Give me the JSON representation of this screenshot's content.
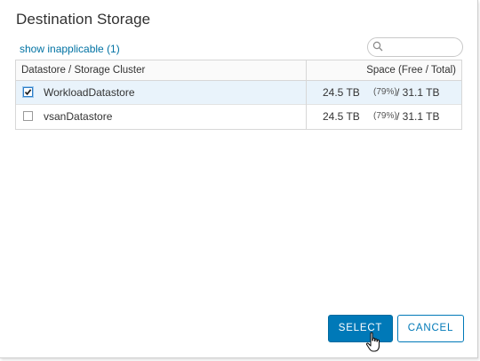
{
  "dialog": {
    "title": "Destination Storage",
    "show_inapplicable": "show inapplicable (1)",
    "search": {
      "value": "",
      "placeholder": ""
    }
  },
  "grid": {
    "columns": [
      "Datastore / Storage Cluster",
      "Space (Free / Total)"
    ],
    "rows": [
      {
        "name": "WorkloadDatastore",
        "checked": true,
        "free": "24.5 TB",
        "percent": "(79%)",
        "total": "/ 31.1 TB"
      },
      {
        "name": "vsanDatastore",
        "checked": false,
        "free": "24.5 TB",
        "percent": "(79%)",
        "total": "/ 31.1 TB"
      }
    ]
  },
  "buttons": {
    "select": "SELECT",
    "cancel": "CANCEL"
  },
  "colors": {
    "primary": "#0079b8",
    "link": "#0072a3",
    "selected_row": "#e9f3fb"
  }
}
